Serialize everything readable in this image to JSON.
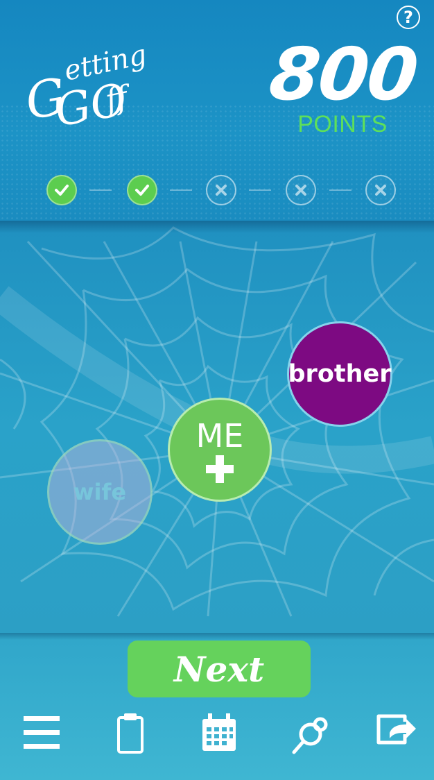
{
  "header": {
    "help_label": "?",
    "logo_text": {
      "line1": "etting",
      "line2": "GO",
      "line3": "ff",
      "initial": "G"
    },
    "points_value": "800",
    "points_label": "POINTS"
  },
  "steps": [
    {
      "status": "done",
      "icon": "check-icon"
    },
    {
      "status": "done",
      "icon": "check-icon"
    },
    {
      "status": "todo",
      "icon": "x-icon"
    },
    {
      "status": "todo",
      "icon": "x-icon"
    },
    {
      "status": "todo",
      "icon": "x-icon"
    }
  ],
  "web": {
    "nodes": {
      "wife": {
        "label": "wife",
        "color": "#c8b4dc"
      },
      "me": {
        "label": "ME",
        "color": "#6cc75a",
        "icon": "plus-icon"
      },
      "brother": {
        "label": "brother",
        "color": "#7d0a82"
      }
    }
  },
  "next_label": "Next",
  "nav": [
    "menu-icon",
    "clipboard-icon",
    "calendar-icon",
    "network-icon",
    "exit-icon"
  ],
  "colors": {
    "accent_green": "#5ee05a",
    "header_blue": "#1587c0",
    "footer_blue": "#3fb6d2"
  }
}
